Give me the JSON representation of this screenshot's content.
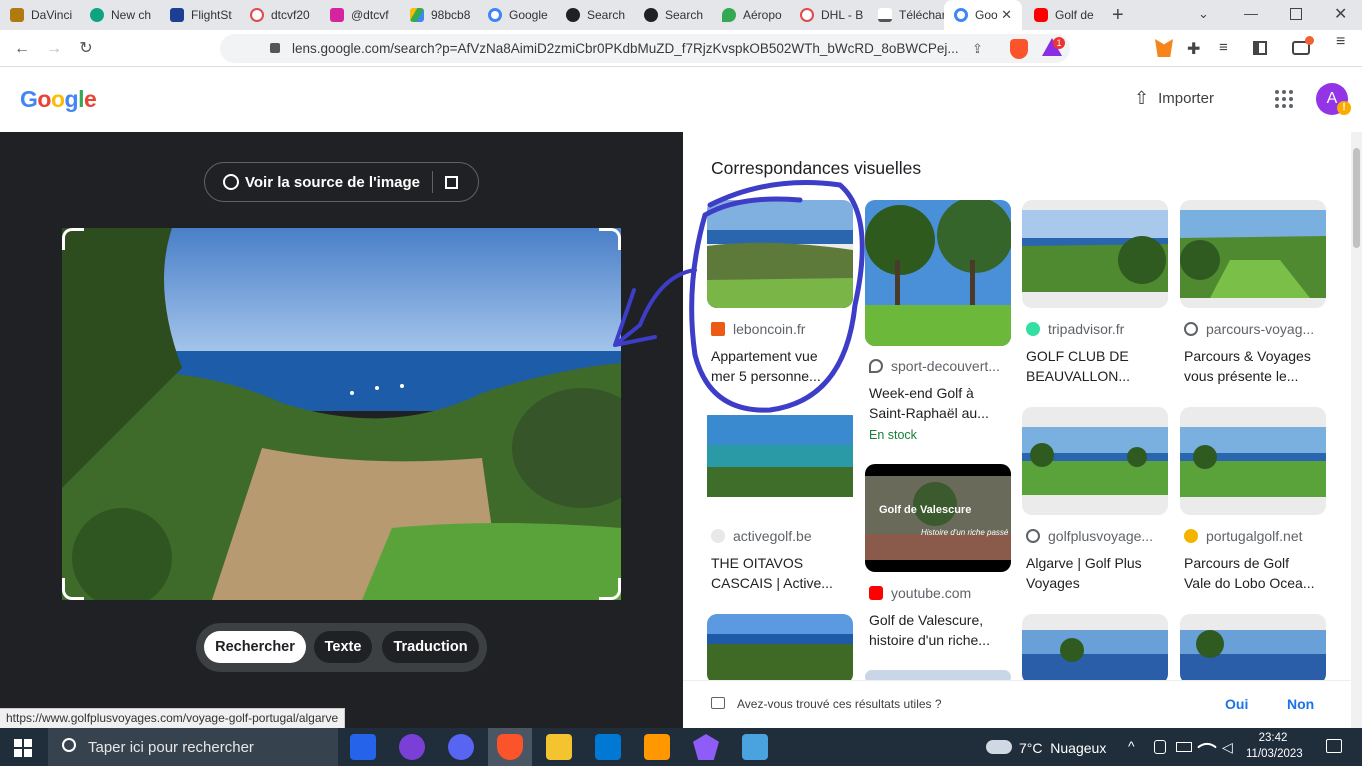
{
  "browser": {
    "tabs": [
      {
        "label": "DaVinci",
        "color": "#b07a10"
      },
      {
        "label": "New ch",
        "color": "#10a37f"
      },
      {
        "label": "FlightSt",
        "color": "#1c3f94"
      },
      {
        "label": "dtcvf20",
        "color": "#e04a4a"
      },
      {
        "label": "@dtcvf",
        "color": "#d6249f"
      },
      {
        "label": "98bcb8",
        "color": "#34a853"
      },
      {
        "label": "Google",
        "color": "#4285f4"
      },
      {
        "label": "Search",
        "color": "#202124"
      },
      {
        "label": "Search",
        "color": "#202124"
      },
      {
        "label": "Aéropo",
        "color": "#34a853"
      },
      {
        "label": "DHL - B",
        "color": "#e04a4a"
      },
      {
        "label": "Téléchar",
        "color": "#555555"
      },
      {
        "label": "Goo",
        "color": "#4285f4"
      },
      {
        "label": "Golf de",
        "color": "#ff0000"
      }
    ],
    "new_tab": "+",
    "url": "lens.google.com/search?p=AfVzNa8AimiD2zmiCbr0PKdbMuZD_f7RjzKvspkOB502WTh_bWcRD_8oBWCPej...",
    "status_url": "https://www.golfplusvoyages.com/voyage-golf-portugal/algarve",
    "extension_badge": "1"
  },
  "header": {
    "logo": "Google",
    "upload_label": "Importer",
    "avatar_letter": "A"
  },
  "lens": {
    "source_button": "Voir la source de l'image",
    "modes": [
      "Rechercher",
      "Texte",
      "Traduction"
    ]
  },
  "results": {
    "title": "Correspondances visuelles",
    "cards": [
      {
        "source": "leboncoin.fr",
        "title1": "Appartement vue",
        "title2": "mer 5 personne...",
        "icon_color": "#ec5a13"
      },
      {
        "source": "sport-decouvert...",
        "title1": "Week-end Golf à",
        "title2": "Saint-Raphaël au...",
        "stock": "En stock",
        "icon_color": "#5f6368"
      },
      {
        "source": "tripadvisor.fr",
        "title1": "GOLF CLUB DE",
        "title2": "BEAUVALLON...",
        "icon_color": "#34e0a1"
      },
      {
        "source": "parcours-voyag...",
        "title1": "Parcours & Voyages",
        "title2": "vous présente le...",
        "icon_color": "#5f6368"
      },
      {
        "source": "activegolf.be",
        "title1": "THE OITAVOS",
        "title2": "CASCAIS | Active...",
        "icon_color": "#e8e8e8"
      },
      {
        "source": "youtube.com",
        "title1": "Golf de Valescure,",
        "title2": "histoire d'un riche...",
        "icon_color": "#ff0000",
        "overlay1": "Golf de Valescure",
        "overlay2": "Histoire d'un riche passé"
      },
      {
        "source": "golfplusvoyage...",
        "title1": "Algarve | Golf Plus",
        "title2": "Voyages",
        "icon_color": "#5f6368"
      },
      {
        "source": "portugalgolf.net",
        "title1": "Parcours de Golf",
        "title2": "Vale do Lobo Ocea...",
        "icon_color": "#f4b400"
      }
    ],
    "feedback_question": "Avez-vous trouvé ces résultats utiles ?",
    "feedback_yes": "Oui",
    "feedback_no": "Non"
  },
  "taskbar": {
    "search_placeholder": "Taper ici pour rechercher",
    "weather": "7°C  Nuageux",
    "time": "23:42",
    "date": "11/03/2023"
  },
  "colors": {
    "annotation": "#3d3dc8",
    "link_blue": "#1a73e8",
    "dark_panel": "#202124",
    "stock_green": "#188038"
  }
}
